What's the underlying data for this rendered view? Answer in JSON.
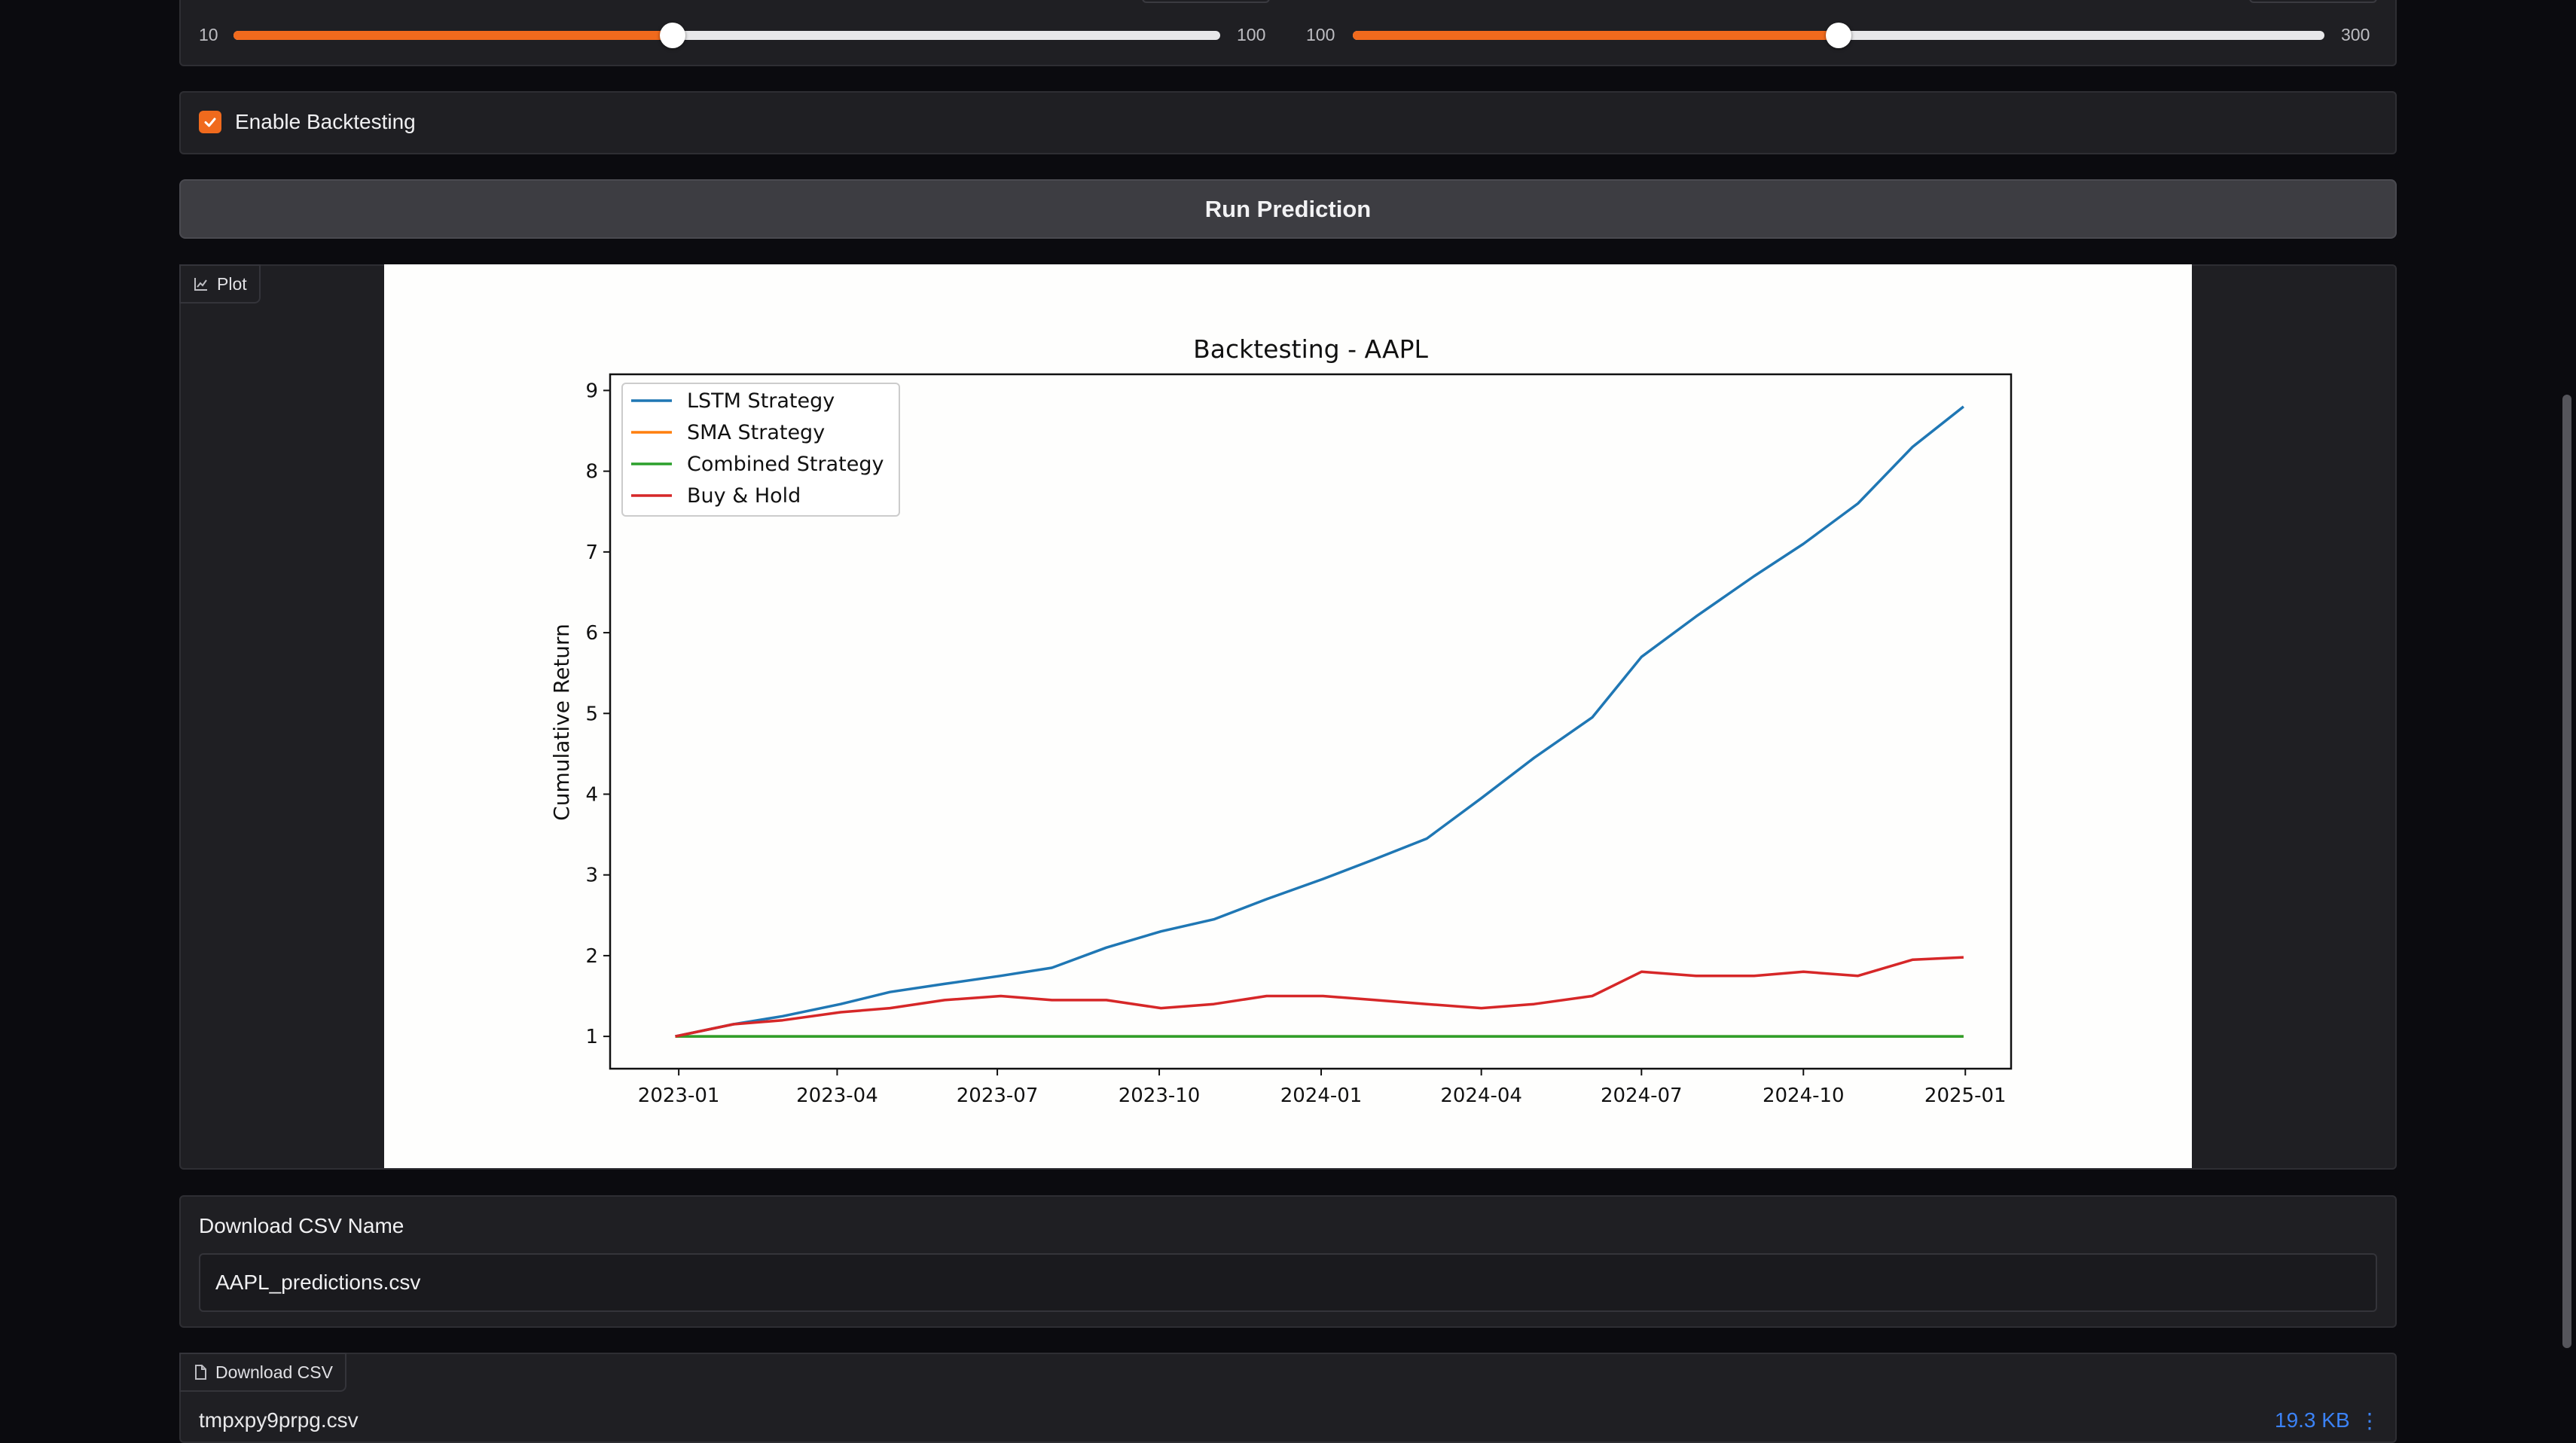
{
  "sliders": [
    {
      "min_label": "10",
      "max_label": "100",
      "fraction": 0.445
    },
    {
      "min_label": "100",
      "max_label": "300",
      "fraction": 0.5
    }
  ],
  "backtesting": {
    "label": "Enable Backtesting",
    "checked": true
  },
  "run_button": {
    "label": "Run Prediction"
  },
  "plot_block": {
    "tag_label": "Plot"
  },
  "chart_data": {
    "type": "line",
    "title": "Backtesting - AAPL",
    "xlabel": "",
    "ylabel": "Cumulative Return",
    "ylim": [
      0.6,
      9.2
    ],
    "xlim": [
      "2022-11-23",
      "2025-01-27"
    ],
    "x_ticks": [
      "2023-01",
      "2023-04",
      "2023-07",
      "2023-10",
      "2024-01",
      "2024-04",
      "2024-07",
      "2024-10",
      "2025-01"
    ],
    "y_ticks": [
      "1",
      "2",
      "3",
      "4",
      "5",
      "6",
      "7",
      "8",
      "9"
    ],
    "legend": "top-left",
    "grid": false,
    "series": [
      {
        "name": "LSTM Strategy",
        "color": "#1f77b4",
        "x": [
          "2022-12-30",
          "2023-02-01",
          "2023-03-01",
          "2023-04-03",
          "2023-05-01",
          "2023-06-01",
          "2023-07-03",
          "2023-08-01",
          "2023-09-01",
          "2023-10-02",
          "2023-11-01",
          "2023-12-01",
          "2024-01-02",
          "2024-02-01",
          "2024-03-01",
          "2024-04-01",
          "2024-05-01",
          "2024-06-03",
          "2024-07-01",
          "2024-08-01",
          "2024-09-03",
          "2024-10-01",
          "2024-11-01",
          "2024-12-02",
          "2024-12-31"
        ],
        "values": [
          1.0,
          1.15,
          1.25,
          1.4,
          1.55,
          1.65,
          1.75,
          1.85,
          2.1,
          2.3,
          2.45,
          2.7,
          2.95,
          3.2,
          3.45,
          3.95,
          4.45,
          4.95,
          5.7,
          6.2,
          6.7,
          7.1,
          7.6,
          8.3,
          8.8
        ]
      },
      {
        "name": "SMA Strategy",
        "color": "#ff7f0e",
        "x": [
          "2022-12-30",
          "2024-12-31"
        ],
        "values": [
          1.0,
          1.0
        ]
      },
      {
        "name": "Combined Strategy",
        "color": "#2ca02c",
        "x": [
          "2022-12-30",
          "2024-12-31"
        ],
        "values": [
          1.0,
          1.0
        ]
      },
      {
        "name": "Buy & Hold",
        "color": "#d62728",
        "x": [
          "2022-12-30",
          "2023-02-01",
          "2023-03-01",
          "2023-04-03",
          "2023-05-01",
          "2023-06-01",
          "2023-07-03",
          "2023-08-01",
          "2023-09-01",
          "2023-10-02",
          "2023-11-01",
          "2023-12-01",
          "2024-01-02",
          "2024-02-01",
          "2024-03-01",
          "2024-04-01",
          "2024-05-01",
          "2024-06-03",
          "2024-07-01",
          "2024-08-01",
          "2024-09-03",
          "2024-10-01",
          "2024-11-01",
          "2024-12-02",
          "2024-12-31"
        ],
        "values": [
          1.0,
          1.15,
          1.2,
          1.3,
          1.35,
          1.45,
          1.5,
          1.45,
          1.45,
          1.35,
          1.4,
          1.5,
          1.5,
          1.45,
          1.4,
          1.35,
          1.4,
          1.5,
          1.8,
          1.75,
          1.75,
          1.8,
          1.75,
          1.95,
          1.98
        ]
      }
    ]
  },
  "csv_name": {
    "label": "Download CSV Name",
    "value": "AAPL_predictions.csv"
  },
  "download": {
    "tag_label": "Download CSV",
    "file_name": "tmpxpy9prpg.csv",
    "file_size": "19.3 KB"
  },
  "colors": {
    "accent": "#f06a1d",
    "panel": "#1f1f23",
    "background": "#0b0b0f",
    "link": "#3b82f6"
  }
}
